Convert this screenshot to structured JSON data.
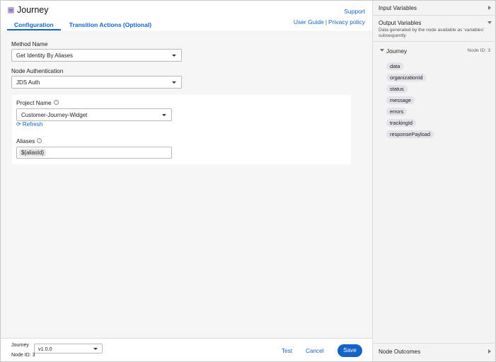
{
  "header": {
    "title": "Journey",
    "icon": "journey-node-icon",
    "tabs": [
      {
        "label": "Configuration",
        "active": true
      },
      {
        "label": "Transition Actions (Optional)",
        "active": false
      }
    ],
    "links": {
      "support": "Support",
      "user_guide": "User Guide",
      "separator": "|",
      "privacy": "Privacy policy"
    }
  },
  "form": {
    "method_name": {
      "label": "Method Name",
      "value": "Get Identity By Aliases"
    },
    "node_auth": {
      "label": "Node Authentication",
      "value": "JDS Auth"
    },
    "project_name": {
      "label": "Project Name",
      "value": "Customer-Journey-Widget",
      "info_icon": "i"
    },
    "refresh": {
      "label": "Refresh",
      "icon": "refresh-icon"
    },
    "aliases": {
      "label": "Aliases",
      "info_icon": "i",
      "chip": "${aliasId}"
    }
  },
  "footer": {
    "node_label": "Journey",
    "version": "v1.0.0",
    "node_id": "Node ID: 3",
    "test": "Test",
    "cancel": "Cancel",
    "save": "Save"
  },
  "right_panel": {
    "input_variables": "Input Variables",
    "output_variables": "Output Variables",
    "output_desc": "Data generated by the node available as 'variables' subsequently",
    "group_name": "Journey",
    "group_node_id": "Node ID: 3",
    "variables": [
      "data",
      "organizationId",
      "status",
      "message",
      "errors",
      "trackingId",
      "responsePayload"
    ],
    "node_outcomes": "Node Outcomes"
  },
  "colors": {
    "accent": "#1464c8",
    "panel_bg": "#f3f3f3",
    "chip_bg": "#e2e2ea"
  }
}
